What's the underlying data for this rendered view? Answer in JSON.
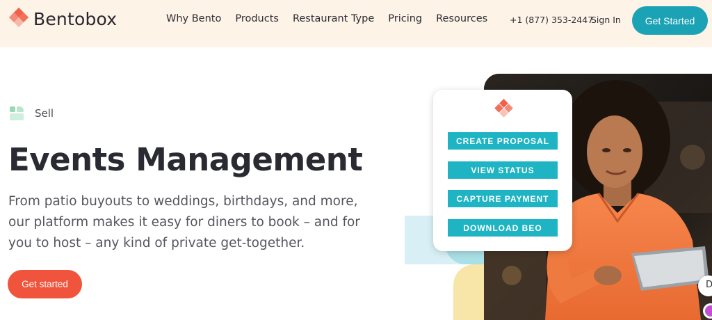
{
  "brand": {
    "name": "Bentobox"
  },
  "nav": {
    "items": [
      {
        "label": "Why Bento"
      },
      {
        "label": "Products"
      },
      {
        "label": "Restaurant Type"
      },
      {
        "label": "Pricing"
      },
      {
        "label": "Resources"
      }
    ],
    "phone": "+1 (877) 353-2447",
    "sign_in": "Sign In",
    "cta": "Get Started"
  },
  "hero": {
    "category": "Sell",
    "title": "Events Management",
    "description": "From patio buyouts to weddings, birthdays, and more, our platform makes it easy for diners to book – and for you to host – any kind of private get-together.",
    "cta": "Get started"
  },
  "card": {
    "buttons": [
      {
        "label": "CREATE PROPOSAL"
      },
      {
        "label": "VIEW STATUS"
      },
      {
        "label": "CAPTURE PAYMENT"
      },
      {
        "label": "DOWNLOAD BEO"
      }
    ]
  },
  "edge_bubble": {
    "text": "D"
  },
  "colors": {
    "header_bg": "#fdf3e7",
    "teal": "#1ba2b5",
    "coral": "#f0543c",
    "card_button": "#1fb4c3"
  }
}
